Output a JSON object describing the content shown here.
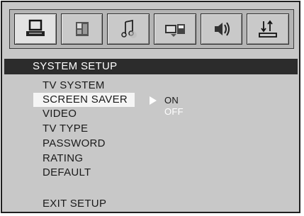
{
  "tabs": [
    {
      "icon": "pc-icon",
      "active": true
    },
    {
      "icon": "picture-icon",
      "active": false
    },
    {
      "icon": "music-note-icon",
      "active": false
    },
    {
      "icon": "video-camera-icon",
      "active": false
    },
    {
      "icon": "speaker-icon",
      "active": false
    },
    {
      "icon": "setup-arrows-icon",
      "active": false
    }
  ],
  "header": {
    "title": "SYSTEM SETUP"
  },
  "menu": {
    "items": [
      {
        "label": "TV SYSTEM"
      },
      {
        "label": "SCREEN SAVER",
        "selected": true
      },
      {
        "label": "VIDEO"
      },
      {
        "label": "TV TYPE"
      },
      {
        "label": "PASSWORD"
      },
      {
        "label": "RATING"
      },
      {
        "label": "DEFAULT"
      }
    ],
    "exit_label": "EXIT SETUP"
  },
  "submenu": {
    "options": [
      {
        "label": "ON",
        "highlighted": false
      },
      {
        "label": "OFF",
        "highlighted": true
      }
    ]
  },
  "colors": {
    "panel": "#c8c8c8",
    "header_bar": "#2c2c2c",
    "selection": "#f5f5f5",
    "text": "#1a1a1a",
    "highlight_text": "#ffffff"
  }
}
